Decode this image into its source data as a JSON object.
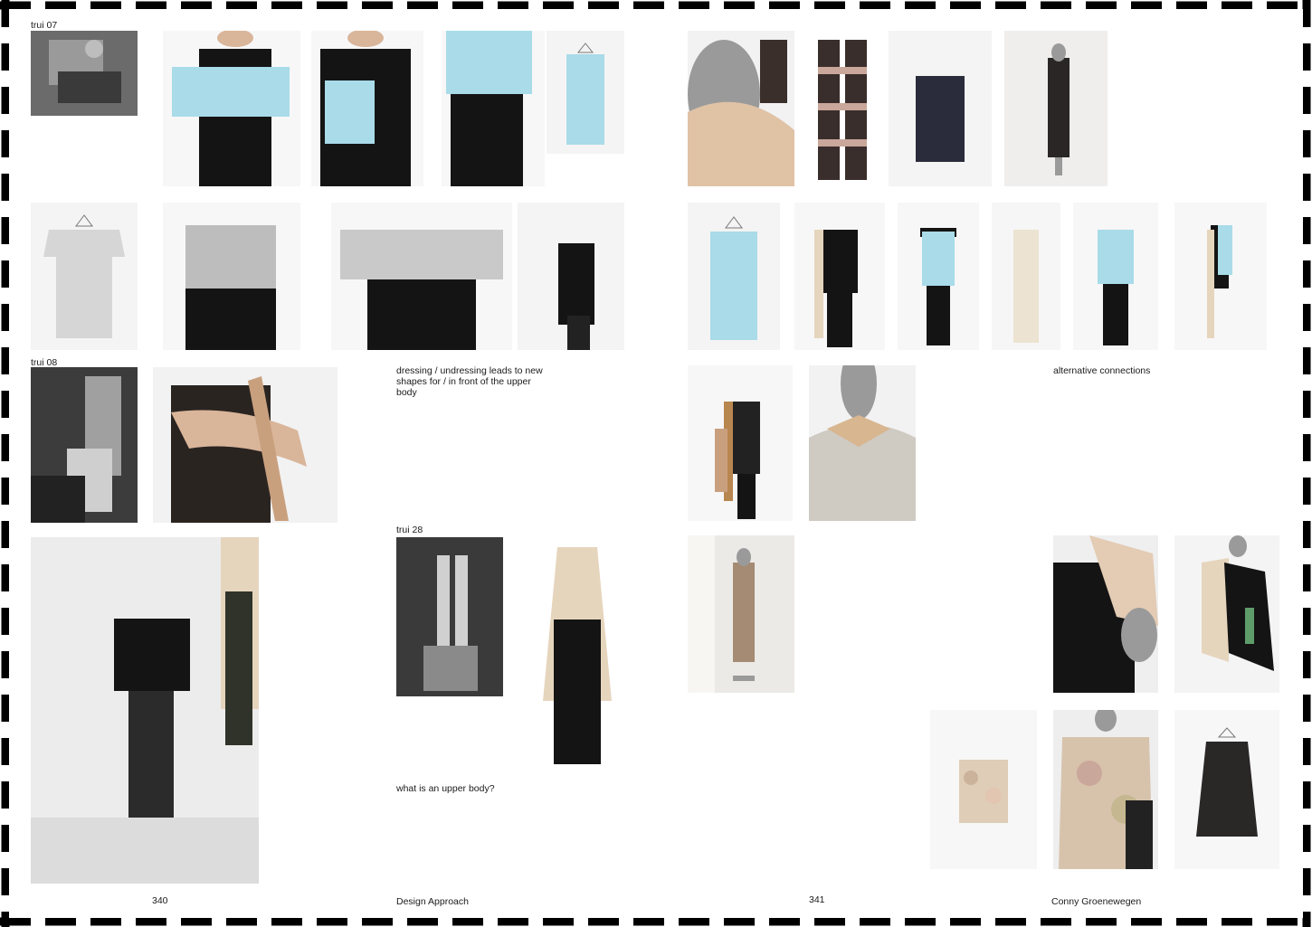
{
  "spread": {
    "left_page_number": "340",
    "right_page_number": "341",
    "left_footer": "Design Approach",
    "right_footer": "Conny Groenewegen"
  },
  "labels": {
    "trui07": "trui 07",
    "trui08": "trui 08",
    "trui28": "trui 28"
  },
  "captions": {
    "dressing": "dressing / undressing leads to new shapes for / in front of the upper body",
    "upper_body": "what is an upper body?",
    "alternative": "alternative connections"
  },
  "colors": {
    "frame_stroke": "#000000",
    "page_bg": "#ffffff",
    "text": "#1a1a1a",
    "light_blue": "#a9dbe9",
    "black_garment": "#141414",
    "skin": "#d9b59a",
    "beige": "#e6d5bd",
    "grey_tee": "#d6d6d6",
    "mannequin": "#9a9a9a"
  }
}
